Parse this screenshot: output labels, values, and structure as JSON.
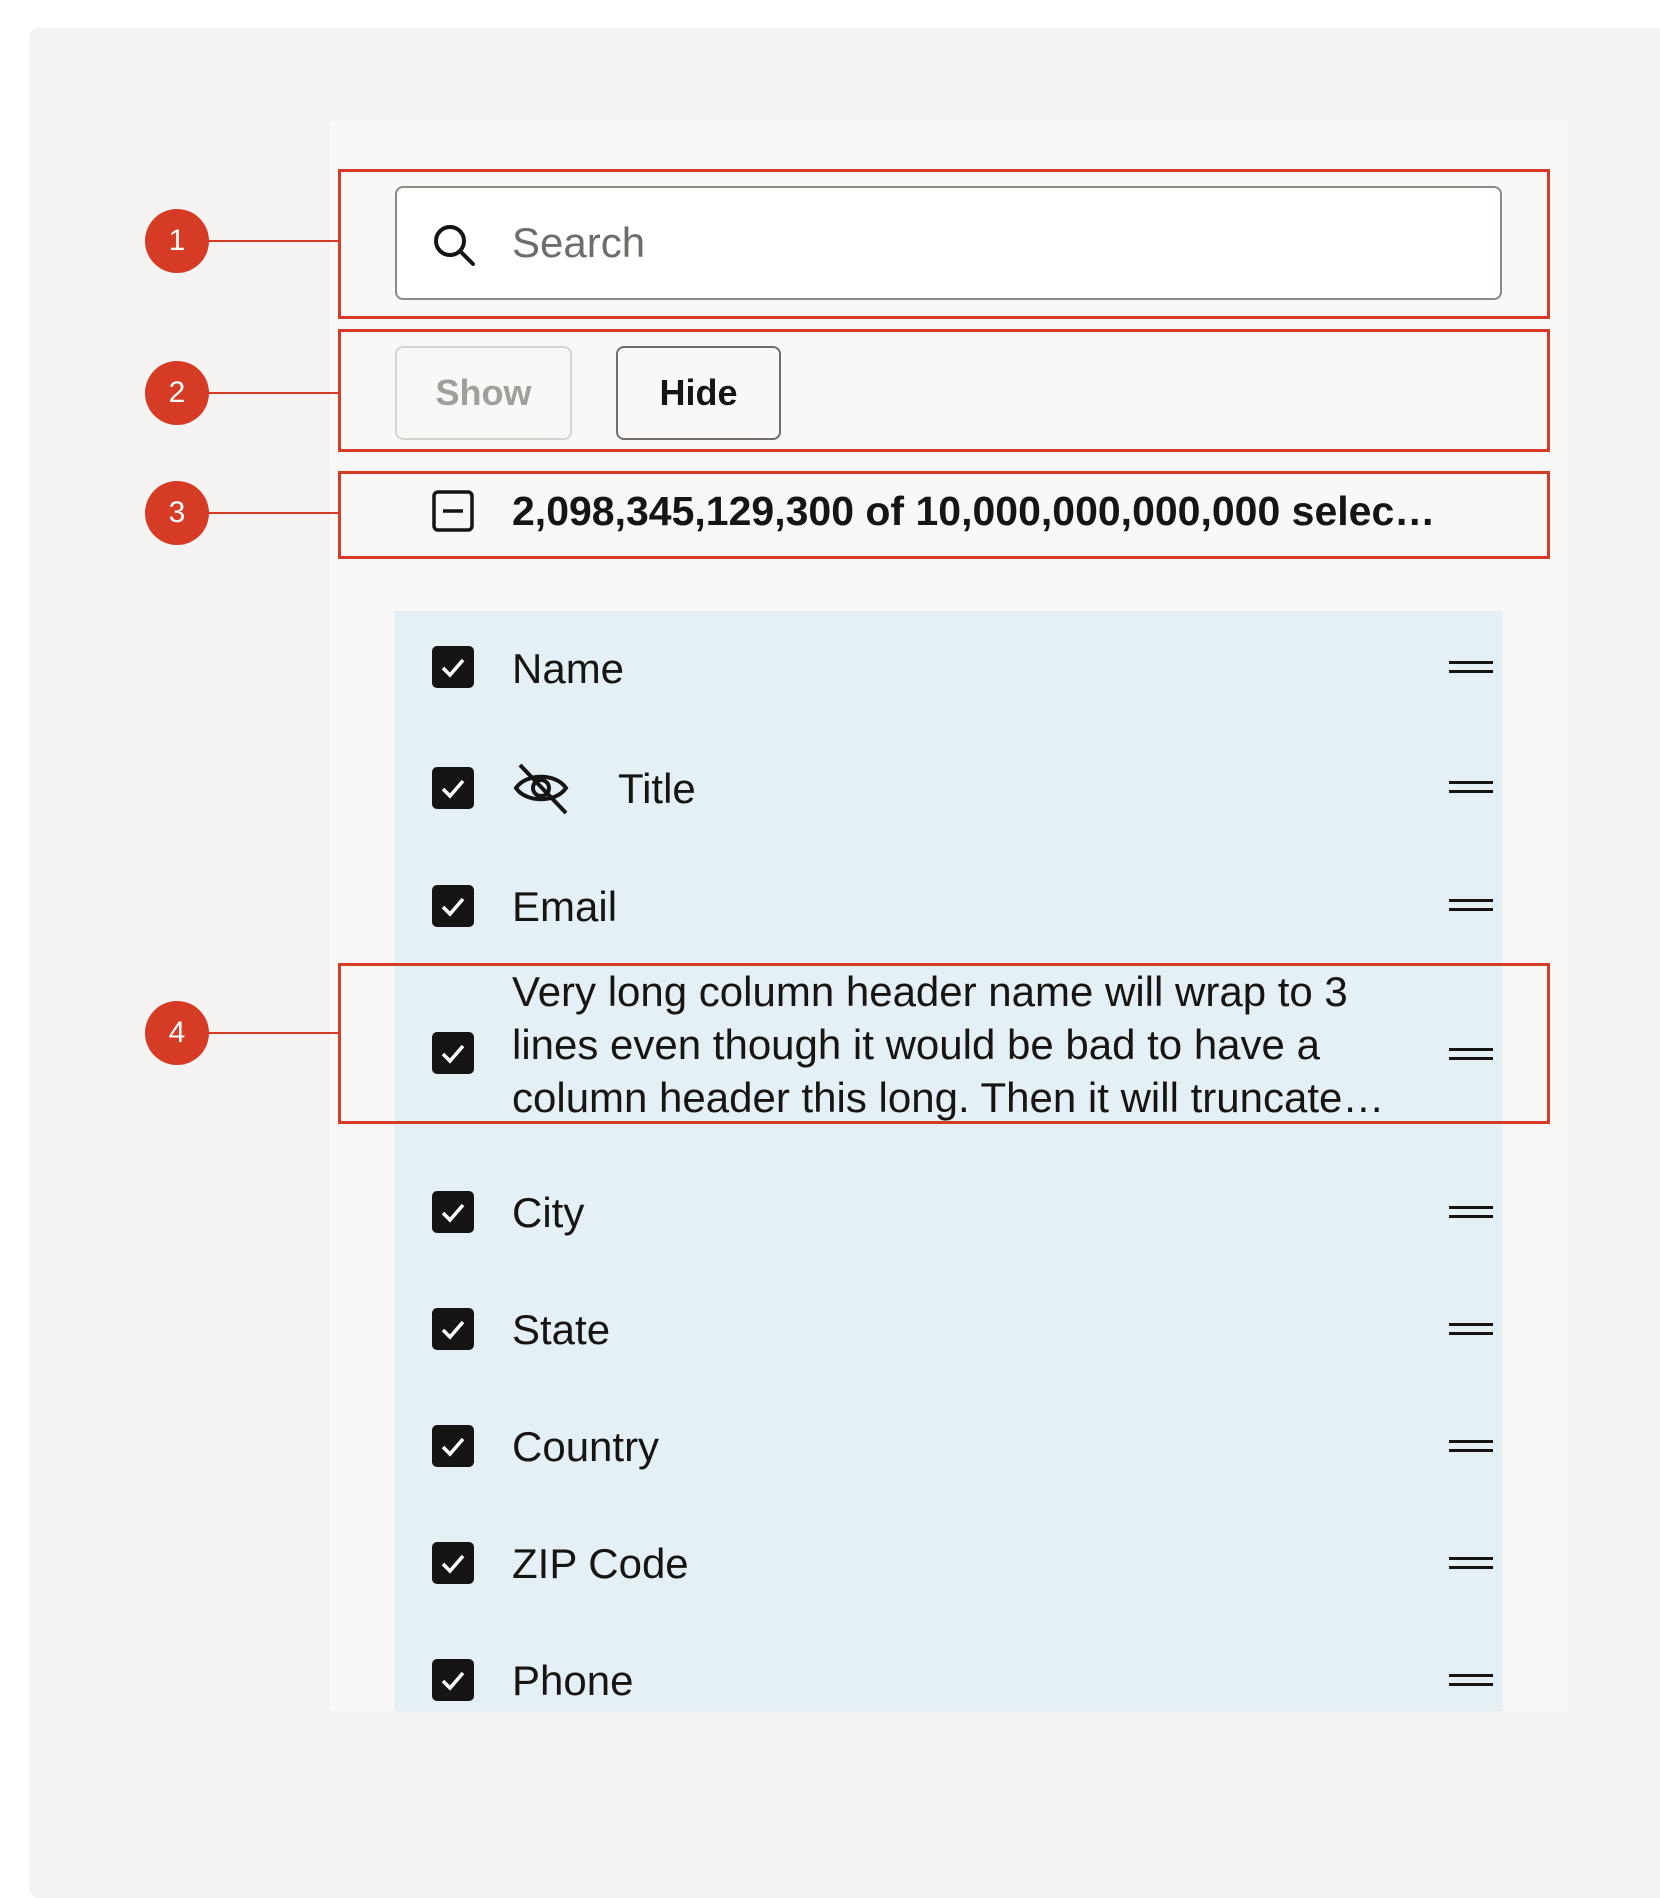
{
  "search": {
    "placeholder": "Search",
    "icon": "search-icon"
  },
  "buttons": {
    "show": "Show",
    "hide": "Hide"
  },
  "select_all": {
    "text": "2,098,345,129,300 of 10,000,000,000,000 selec…",
    "icon": "minus-square-icon"
  },
  "columns": [
    {
      "label": "Name",
      "checked": true,
      "hidden_icon": false
    },
    {
      "label": "Title",
      "checked": true,
      "hidden_icon": true
    },
    {
      "label": "Email",
      "checked": true,
      "hidden_icon": false
    },
    {
      "label": "Very long column header name will wrap to 3 lines even though it would be bad to have a column header this long.  Then it will truncate…",
      "checked": true,
      "hidden_icon": false
    },
    {
      "label": "City",
      "checked": true,
      "hidden_icon": false
    },
    {
      "label": "State",
      "checked": true,
      "hidden_icon": false
    },
    {
      "label": "Country",
      "checked": true,
      "hidden_icon": false
    },
    {
      "label": "ZIP Code",
      "checked": true,
      "hidden_icon": false
    },
    {
      "label": "Phone",
      "checked": true,
      "hidden_icon": false
    }
  ],
  "callouts": [
    "1",
    "2",
    "3",
    "4"
  ],
  "colors": {
    "annotation": "#d63b25",
    "list_background": "#e4f0f6",
    "checkbox": "#161513"
  }
}
